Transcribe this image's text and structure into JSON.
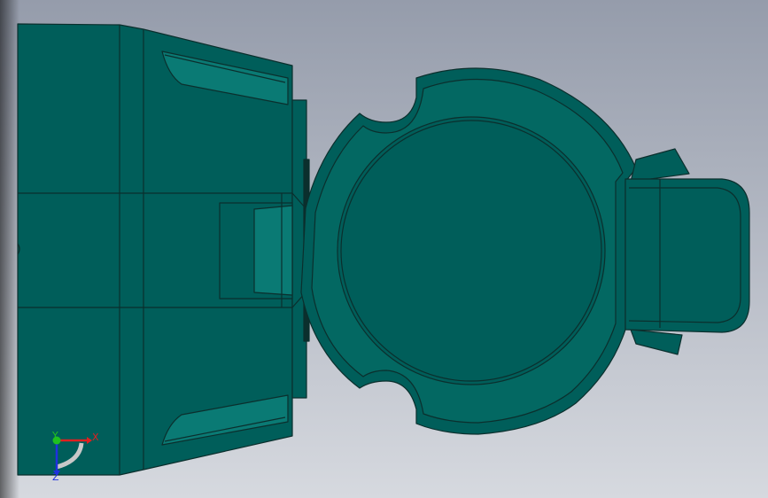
{
  "viewport": {
    "background_top": "#959cab",
    "background_bottom": "#d6d9df",
    "model_color": "#005e5a",
    "model_edge_color": "#0b2f2d",
    "model_highlight_color": "#0a7a74"
  },
  "triad": {
    "x_label": "X",
    "y_label": "Y",
    "z_label": "Z",
    "x_color": "#e02020",
    "y_color": "#20c020",
    "z_color": "#2030e0"
  }
}
